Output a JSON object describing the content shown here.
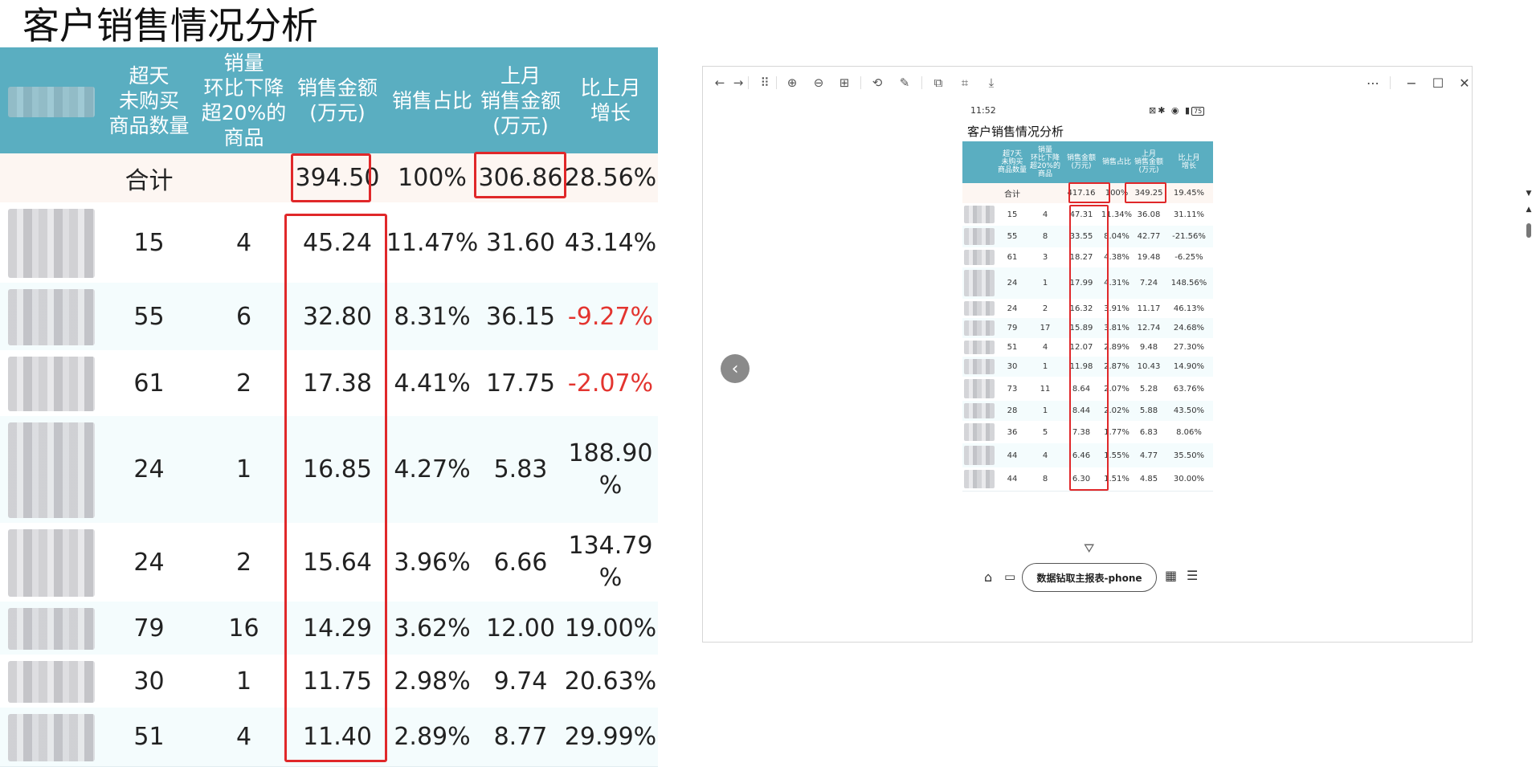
{
  "report": {
    "title": "客户销售情况分析",
    "headers": [
      "超天\n未购买\n商品数量",
      "销量\n环比下降\n超20%的\n商品",
      "销售金额\n(万元)",
      "销售占比",
      "上月\n销售金额\n(万元)",
      "比上月\n增长"
    ],
    "total": {
      "label": "合计",
      "sales": "394.50",
      "share": "100%",
      "last_month": "306.86",
      "growth": "28.56%"
    },
    "rows": [
      {
        "days": "15",
        "drop": "4",
        "sales": "45.24",
        "share": "11.47%",
        "last_month": "31.60",
        "growth": "43.14%",
        "negative": false
      },
      {
        "days": "55",
        "drop": "6",
        "sales": "32.80",
        "share": "8.31%",
        "last_month": "36.15",
        "growth": "-9.27%",
        "negative": true
      },
      {
        "days": "61",
        "drop": "2",
        "sales": "17.38",
        "share": "4.41%",
        "last_month": "17.75",
        "growth": "-2.07%",
        "negative": true
      },
      {
        "days": "24",
        "drop": "1",
        "sales": "16.85",
        "share": "4.27%",
        "last_month": "5.83",
        "growth": "188.90\n%",
        "negative": false
      },
      {
        "days": "24",
        "drop": "2",
        "sales": "15.64",
        "share": "3.96%",
        "last_month": "6.66",
        "growth": "134.79\n%",
        "negative": false
      },
      {
        "days": "79",
        "drop": "16",
        "sales": "14.29",
        "share": "3.62%",
        "last_month": "12.00",
        "growth": "19.00%",
        "negative": false
      },
      {
        "days": "30",
        "drop": "1",
        "sales": "11.75",
        "share": "2.98%",
        "last_month": "9.74",
        "growth": "20.63%",
        "negative": false
      },
      {
        "days": "51",
        "drop": "4",
        "sales": "11.40",
        "share": "2.89%",
        "last_month": "8.77",
        "growth": "29.99%",
        "negative": false
      }
    ]
  },
  "viewer": {
    "toolbar_icons": [
      "back-arrow-icon",
      "forward-arrow-icon",
      "grid-icon",
      "zoom-in-icon",
      "zoom-out-icon",
      "fit-width-icon",
      "rotate-icon",
      "edit-icon",
      "copy-icon",
      "scan-icon",
      "download-icon"
    ],
    "window_buttons": [
      "more-icon",
      "minimize-icon",
      "maximize-icon",
      "close-icon"
    ],
    "phone": {
      "status_time": "11:52",
      "status_battery": "75",
      "title": "客户销售情况分析",
      "headers": [
        "超7天\n未购买\n商品数量",
        "销量\n环比下降\n超20%的\n商品",
        "销售金额\n(万元)",
        "销售占比",
        "上月\n销售金额\n(万元)",
        "比上月\n增长"
      ],
      "total": {
        "label": "合计",
        "sales": "417.16",
        "share": "100%",
        "last_month": "349.25",
        "growth": "19.45%"
      },
      "rows": [
        {
          "days": "15",
          "drop": "4",
          "sales": "47.31",
          "share": "11.34%",
          "last_month": "36.08",
          "growth": "31.11%",
          "negative": false
        },
        {
          "days": "55",
          "drop": "8",
          "sales": "33.55",
          "share": "8.04%",
          "last_month": "42.77",
          "growth": "-21.56%",
          "negative": true
        },
        {
          "days": "61",
          "drop": "3",
          "sales": "18.27",
          "share": "4.38%",
          "last_month": "19.48",
          "growth": "-6.25%",
          "negative": true
        },
        {
          "days": "24",
          "drop": "1",
          "sales": "17.99",
          "share": "4.31%",
          "last_month": "7.24",
          "growth": "148.56%",
          "negative": false
        },
        {
          "days": "24",
          "drop": "2",
          "sales": "16.32",
          "share": "3.91%",
          "last_month": "11.17",
          "growth": "46.13%",
          "negative": false
        },
        {
          "days": "79",
          "drop": "17",
          "sales": "15.89",
          "share": "3.81%",
          "last_month": "12.74",
          "growth": "24.68%",
          "negative": false
        },
        {
          "days": "51",
          "drop": "4",
          "sales": "12.07",
          "share": "2.89%",
          "last_month": "9.48",
          "growth": "27.30%",
          "negative": false
        },
        {
          "days": "30",
          "drop": "1",
          "sales": "11.98",
          "share": "2.87%",
          "last_month": "10.43",
          "growth": "14.90%",
          "negative": false
        },
        {
          "days": "73",
          "drop": "11",
          "sales": "8.64",
          "share": "2.07%",
          "last_month": "5.28",
          "growth": "63.76%",
          "negative": false
        },
        {
          "days": "28",
          "drop": "1",
          "sales": "8.44",
          "share": "2.02%",
          "last_month": "5.88",
          "growth": "43.50%",
          "negative": false
        },
        {
          "days": "36",
          "drop": "5",
          "sales": "7.38",
          "share": "1.77%",
          "last_month": "6.83",
          "growth": "8.06%",
          "negative": false
        },
        {
          "days": "44",
          "drop": "4",
          "sales": "6.46",
          "share": "1.55%",
          "last_month": "4.77",
          "growth": "35.50%",
          "negative": false
        },
        {
          "days": "44",
          "drop": "8",
          "sales": "6.30",
          "share": "1.51%",
          "last_month": "4.85",
          "growth": "30.00%",
          "negative": false
        }
      ],
      "bottom": {
        "chip_label": "数据钻取主报表-phone"
      }
    }
  },
  "colors": {
    "header": "#5aaec1",
    "highlight": "#e0282a",
    "negative": "#e3342f",
    "total_row": "#fdf6f2",
    "alt_row": "#f4fcfd"
  }
}
